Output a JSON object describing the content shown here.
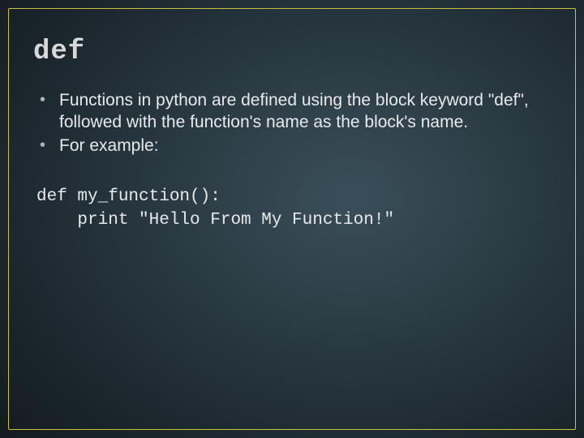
{
  "title": "def",
  "bullets": [
    "Functions in python are defined using the block keyword \"def\", followed with the function's name as the block's name.",
    "For example:"
  ],
  "code": "def my_function():\n    print \"Hello From My Function!\""
}
